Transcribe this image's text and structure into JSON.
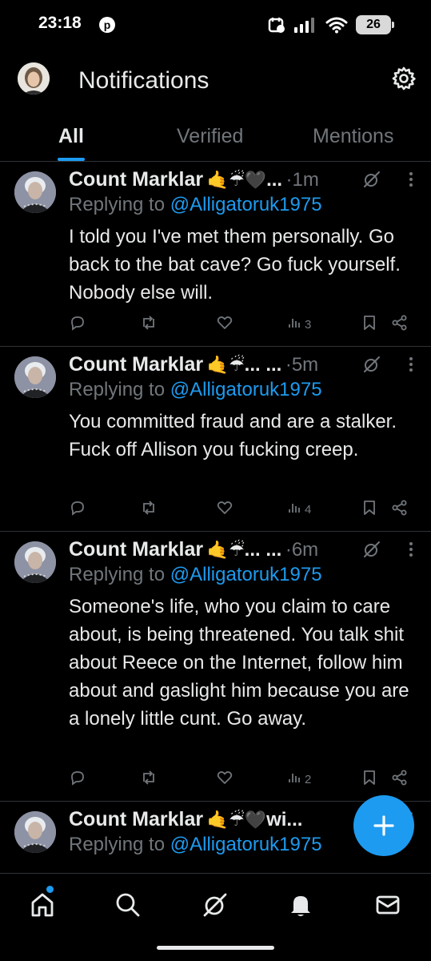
{
  "status_bar": {
    "time": "23:18",
    "pinterest_glyph": "p",
    "battery": "26"
  },
  "header": {
    "title": "Notifications",
    "avatar_icon": "profile-avatar",
    "settings_icon": "gear-icon"
  },
  "tabs": [
    {
      "label": "All",
      "active": true
    },
    {
      "label": "Verified",
      "active": false
    },
    {
      "label": "Mentions",
      "active": false
    }
  ],
  "tweets": [
    {
      "name": "Count Marklar",
      "badges": "🤙☔🖤",
      "truncation": "...",
      "separator": "·",
      "time": "1m",
      "reply_prefix": "Replying to",
      "handle": "@Alligatoruk1975",
      "text": "I told you I've met them personally. Go back to the bat cave? Go fuck yourself. Nobody else will.",
      "views": "3"
    },
    {
      "name": "Count Marklar",
      "badges": "🤙☔",
      "truncation": "... ...",
      "separator": "·",
      "time": "5m",
      "reply_prefix": "Replying to",
      "handle": "@Alligatoruk1975",
      "text": "You committed fraud and are a stalker. Fuck off Allison you fucking creep.",
      "views": "4"
    },
    {
      "name": "Count Marklar",
      "badges": "🤙☔",
      "truncation": "... ...",
      "separator": "·",
      "time": "6m",
      "reply_prefix": "Replying to",
      "handle": "@Alligatoruk1975",
      "text": "Someone's life, who you claim to care about, is being threatened. You talk shit about Reece on the Internet, follow him about and gaslight him because you are a lonely little cunt. Go away.",
      "views": "2"
    },
    {
      "name": "Count Marklar",
      "badges": "🤙☔🖤",
      "truncation": "wi...",
      "separator": "",
      "time": "",
      "reply_prefix": "Replying to",
      "handle": "@Alligatoruk1975",
      "text": "",
      "views": ""
    }
  ],
  "bottom_nav": [
    {
      "icon": "home-icon",
      "active": true,
      "has_dot": true
    },
    {
      "icon": "search-icon",
      "active": false
    },
    {
      "icon": "grok-icon",
      "active": false
    },
    {
      "icon": "bell-icon",
      "active": false
    },
    {
      "icon": "mail-icon",
      "active": false
    }
  ],
  "fab": {
    "icon": "plus-icon"
  },
  "colors": {
    "accent": "#1d9bf0",
    "muted": "#71767b",
    "text": "#e7e9ea",
    "background": "#000000",
    "divider": "#2f3336"
  }
}
